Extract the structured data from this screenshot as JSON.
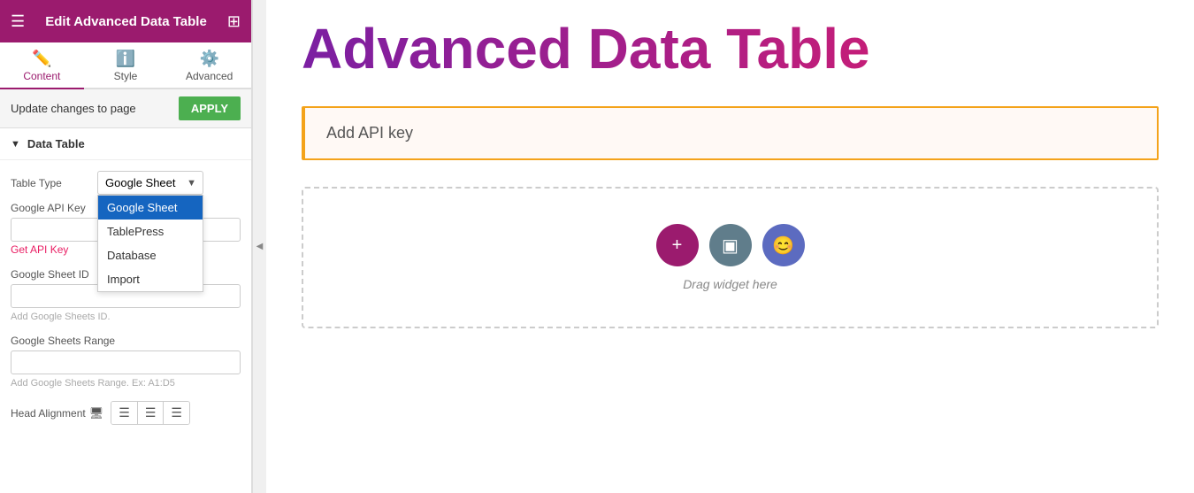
{
  "header": {
    "title": "Edit Advanced Data Table"
  },
  "tabs": [
    {
      "id": "content",
      "label": "Content",
      "icon": "✏️",
      "active": true
    },
    {
      "id": "style",
      "label": "Style",
      "icon": "ℹ️",
      "active": false
    },
    {
      "id": "advanced",
      "label": "Advanced",
      "icon": "⚙️",
      "active": false
    }
  ],
  "update_bar": {
    "label": "Update changes to page",
    "apply_label": "APPLY"
  },
  "section": {
    "label": "Data Table"
  },
  "form": {
    "table_type_label": "Table Type",
    "table_type_value": "Google Sheet",
    "dropdown_options": [
      {
        "value": "google_sheet",
        "label": "Google Sheet",
        "selected": true
      },
      {
        "value": "tablepress",
        "label": "TablePress",
        "selected": false
      },
      {
        "value": "database",
        "label": "Database",
        "selected": false
      },
      {
        "value": "import",
        "label": "Import",
        "selected": false
      }
    ],
    "google_api_key_label": "Google API Key",
    "google_api_key_value": "",
    "get_api_key_label": "Get API Key",
    "google_sheet_id_label": "Google Sheet ID",
    "google_sheet_id_value": "",
    "google_sheet_id_hint": "Add Google Sheets ID.",
    "google_sheets_range_label": "Google Sheets Range",
    "google_sheets_range_value": "",
    "google_sheets_range_hint": "Add Google Sheets Range. Ex: A1:D5",
    "head_alignment_label": "Head Alignment"
  },
  "main": {
    "title": "Advanced Data Table",
    "api_key_box_text": "Add API key",
    "drag_widget_label": "Drag widget here"
  },
  "icons": {
    "hamburger": "☰",
    "grid": "⊞",
    "content_icon": "✏️",
    "style_icon": "ℹ️",
    "advanced_icon": "⚙️",
    "arrow_down": "▼",
    "arrow_left": "◀",
    "monitor_icon": "🖥",
    "align_left": "≡",
    "align_center": "≡",
    "align_right": "≡",
    "add_icon": "+",
    "widget_icon": "▣",
    "emoji_icon": "😊"
  }
}
